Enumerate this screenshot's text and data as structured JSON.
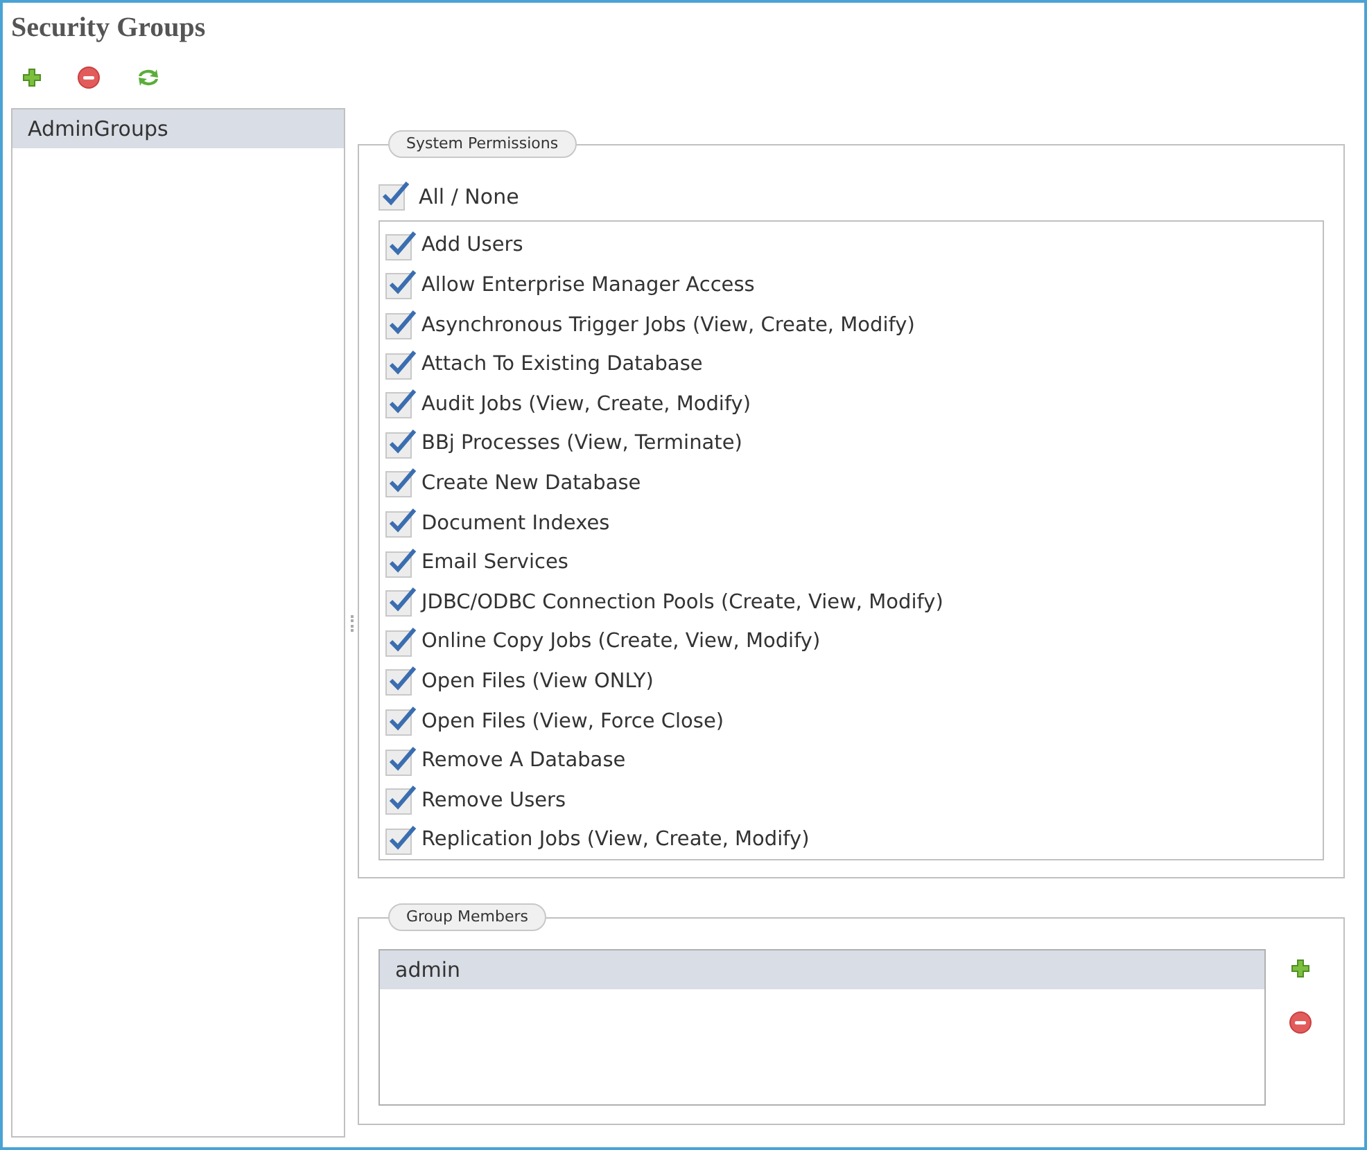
{
  "title": "Security Groups",
  "groups": [
    {
      "label": "AdminGroups",
      "selected": true
    }
  ],
  "permissions": {
    "legend": "System Permissions",
    "all": {
      "label": "All / None",
      "checked": true
    },
    "items": [
      {
        "label": "Add Users",
        "checked": true
      },
      {
        "label": "Allow Enterprise Manager Access",
        "checked": true
      },
      {
        "label": "Asynchronous Trigger Jobs (View, Create, Modify)",
        "checked": true
      },
      {
        "label": "Attach To Existing Database",
        "checked": true
      },
      {
        "label": "Audit Jobs (View, Create, Modify)",
        "checked": true
      },
      {
        "label": "BBj Processes (View, Terminate)",
        "checked": true
      },
      {
        "label": "Create New Database",
        "checked": true
      },
      {
        "label": "Document Indexes",
        "checked": true
      },
      {
        "label": "Email Services",
        "checked": true
      },
      {
        "label": "JDBC/ODBC Connection Pools (Create, View, Modify)",
        "checked": true
      },
      {
        "label": "Online Copy Jobs (Create, View, Modify)",
        "checked": true
      },
      {
        "label": "Open Files (View ONLY)",
        "checked": true
      },
      {
        "label": "Open Files (View, Force Close)",
        "checked": true
      },
      {
        "label": "Remove A Database",
        "checked": true
      },
      {
        "label": "Remove Users",
        "checked": true
      },
      {
        "label": "Replication Jobs (View, Create, Modify)",
        "checked": true
      }
    ]
  },
  "members": {
    "legend": "Group Members",
    "items": [
      {
        "label": "admin",
        "selected": true
      }
    ]
  }
}
